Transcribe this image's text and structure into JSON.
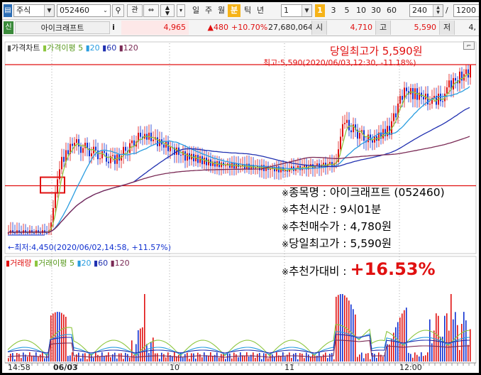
{
  "toolbar": {
    "market": "주식",
    "code": "052460",
    "btn_gwan": "관",
    "periods": [
      "일",
      "주",
      "월",
      "분",
      "틱",
      "년"
    ],
    "active_period": "분",
    "period_select": "1",
    "minute_active": "1",
    "minute_options": [
      "1",
      "3",
      "5",
      "10",
      "30",
      "60"
    ],
    "count": "240",
    "slash": "/",
    "total": "1200"
  },
  "quote": {
    "badge": "신",
    "name": "아이크래프트",
    "info": "i",
    "price": "4,965",
    "change": "▲480",
    "rate": "+10.70%",
    "volume": "27,680,064",
    "open_label": "시",
    "open": "4,710",
    "high_label": "고",
    "high": "5,590",
    "low_label": "저",
    "low": "4,"
  },
  "price_panel": {
    "title": "가격차트",
    "ma_label": "가격이평",
    "ma_values": [
      "5",
      "20",
      "60",
      "120"
    ],
    "ma_colors": [
      "#8dc63f",
      "#2a9de0",
      "#2030b0",
      "#7a2a55"
    ],
    "headline": "당일최고가 5,590원",
    "high_note": "최고:5,590(2020/06/03,12:30, -11.18%)",
    "low_note": "←최저:4,450(2020/06/02,14:58, +11.57%)"
  },
  "volume_panel": {
    "title": "거래량",
    "ma_label": "거래이평",
    "ma_values": [
      "5",
      "20",
      "60",
      "120"
    ],
    "ma_colors": [
      "#8dc63f",
      "#2a9de0",
      "#2030b0",
      "#7a2a55"
    ]
  },
  "info_box": {
    "mark": "※",
    "lines": [
      "종목명 : 아이크래프트 (052460)",
      "추천시간 : 9시01분",
      "추천매수가 : 4,780원",
      "당일최고가 : 5,590원"
    ],
    "ratio_label": "추천가대비 :",
    "ratio_value": "+16.53%"
  },
  "x_axis": {
    "labels": [
      "14:58",
      "06/03",
      "10",
      "11",
      "12:00"
    ]
  },
  "colors": {
    "up": "#e01010",
    "down": "#1030d0",
    "highlight": "#f6b318"
  }
}
